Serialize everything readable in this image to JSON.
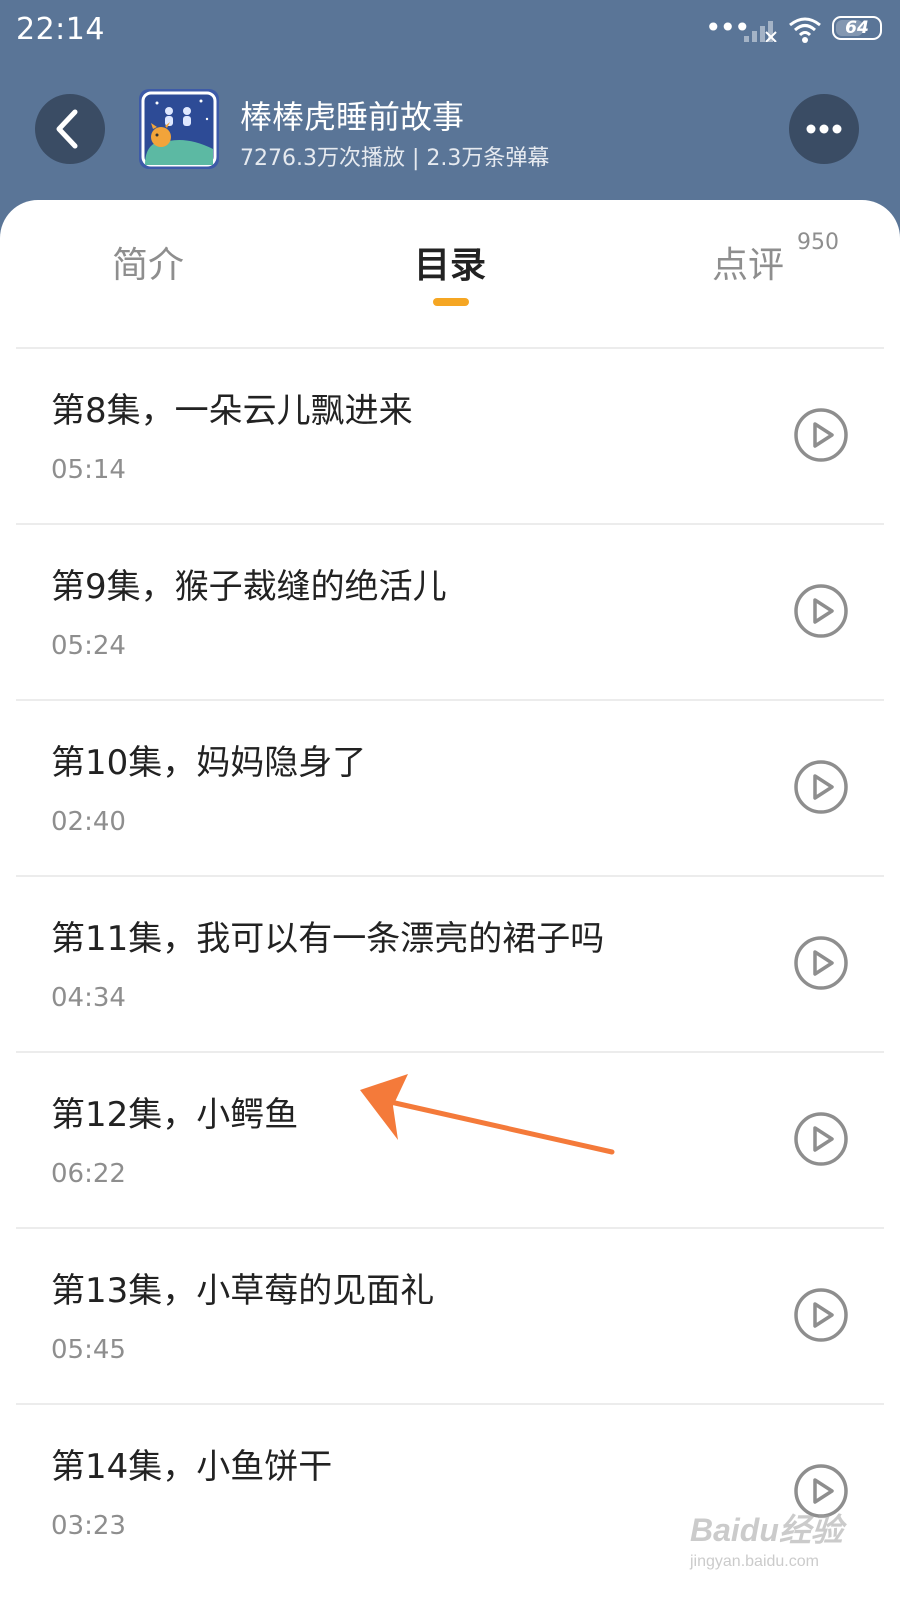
{
  "status_bar": {
    "time": "22:14",
    "battery": "64",
    "battery_level": 0.64
  },
  "header": {
    "title": "棒棒虎睡前故事",
    "stats": "7276.3万次播放 | 2.3万条弹幕"
  },
  "tabs": [
    {
      "label": "简介"
    },
    {
      "label": "目录",
      "active": true
    },
    {
      "label": "点评",
      "badge": "950"
    }
  ],
  "episodes": [
    {
      "title": "第8集，一朵云儿飘进来",
      "duration": "05:14"
    },
    {
      "title": "第9集，猴子裁缝的绝活儿",
      "duration": "05:24"
    },
    {
      "title": "第10集，妈妈隐身了",
      "duration": "02:40"
    },
    {
      "title": "第11集，我可以有一条漂亮的裙子吗",
      "duration": "04:34"
    },
    {
      "title": "第12集，小鳄鱼",
      "duration": "06:22"
    },
    {
      "title": "第13集，小草莓的见面礼",
      "duration": "05:45"
    },
    {
      "title": "第14集，小鱼饼干",
      "duration": "03:23"
    }
  ],
  "watermark": {
    "logo": "Baidu经验",
    "url": "jingyan.baidu.com"
  },
  "colors": {
    "header_bg": "#5a7597",
    "accent": "#f5a623",
    "arrow": "#f47a3a"
  },
  "icons": [
    "back-arrow-icon",
    "more-icon",
    "play-icon",
    "wifi-icon",
    "signal-icon",
    "battery-icon"
  ]
}
